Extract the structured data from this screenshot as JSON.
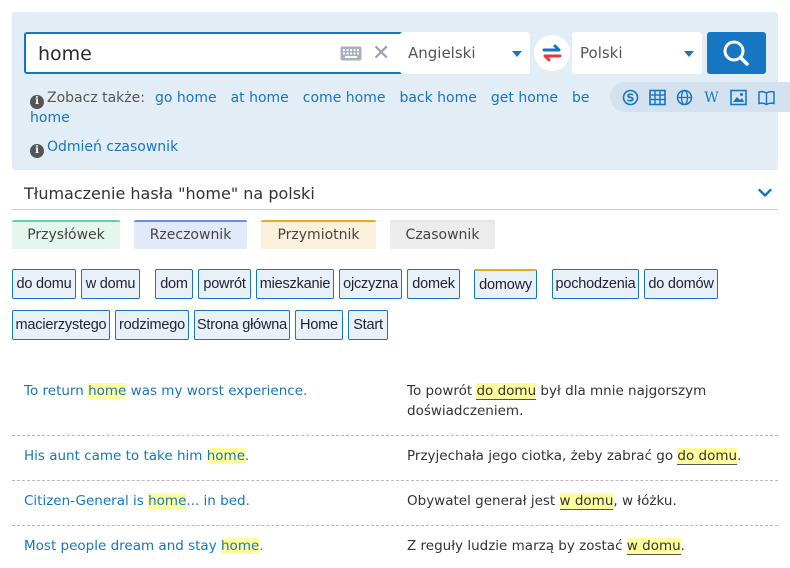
{
  "search": {
    "query": "home",
    "source_language": "Angielski",
    "target_language": "Polski",
    "keyboard_icon": "keyboard-icon",
    "clear_icon": "close-icon",
    "swap_icon": "swap-languages-icon",
    "search_icon": "search-icon"
  },
  "see_also": {
    "label": "Zobacz także:",
    "links": [
      "go home",
      "at home",
      "come home",
      "back home",
      "get home",
      "be home"
    ]
  },
  "conjugate": {
    "label": "Odmień czasownik"
  },
  "tools": [
    "synonyms-icon",
    "table-icon",
    "globe-icon",
    "wikipedia-icon",
    "image-icon",
    "book-icon"
  ],
  "heading": "Tłumaczenie hasła \"home\" na polski",
  "pos_tabs": [
    {
      "label": "Przysłówek",
      "color": "#5ed3a6"
    },
    {
      "label": "Rzeczownik",
      "color": "#6a8ee8"
    },
    {
      "label": "Przymiotnik",
      "color": "#e8a928"
    },
    {
      "label": "Czasownik",
      "color": "#e4e4e4"
    }
  ],
  "translations": [
    "do domu",
    "w domu",
    "dom",
    "powrót",
    "mieszkanie",
    "ojczyzna",
    "domek",
    "domowy",
    "pochodzenia",
    "do domów",
    "macierzystego",
    "rodzimego",
    "Strona główna",
    "Home",
    "Start"
  ],
  "examples": [
    {
      "src_pre": "To return ",
      "src_hl": "home",
      "src_post": " was my worst experience.",
      "trg_pre": "To powrót ",
      "trg_hl": "do domu",
      "trg_post": " był dla mnie najgorszym doświadczeniem."
    },
    {
      "src_pre": "His aunt came to take him ",
      "src_hl": "home",
      "src_post": ".",
      "trg_pre": "Przyjechała jego ciotka, żeby zabrać go ",
      "trg_hl": "do domu",
      "trg_post": "."
    },
    {
      "src_pre": "Citizen-General is ",
      "src_hl": "home",
      "src_post": "... in bed.",
      "trg_pre": "Obywatel generał jest ",
      "trg_hl": "w domu",
      "trg_post": ", w łóżku."
    },
    {
      "src_pre": "Most people dream and stay ",
      "src_hl": "home",
      "src_post": ".",
      "trg_pre": "Z reguły ludzie marzą by zostać ",
      "trg_hl": "w domu",
      "trg_post": "."
    }
  ],
  "colors": {
    "accent": "#1676c2",
    "panel_bg": "#e3edf5",
    "chip_bg": "#e9f1f8",
    "highlight": "#ffff9e"
  }
}
